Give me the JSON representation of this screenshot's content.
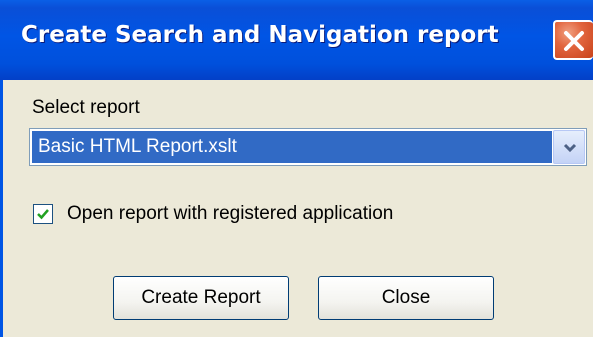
{
  "window": {
    "title": "Create Search and Navigation report"
  },
  "form": {
    "select_label": "Select report",
    "selected_report": "Basic HTML Report.xslt",
    "checkbox_label": "Open report with registered application",
    "checkbox_checked": true
  },
  "buttons": {
    "create_report": "Create Report",
    "close": "Close"
  },
  "colors": {
    "titlebar": "#0055e5",
    "selection": "#316ac5",
    "dialog_bg": "#ece9d8",
    "close_button": "#e2663f"
  }
}
